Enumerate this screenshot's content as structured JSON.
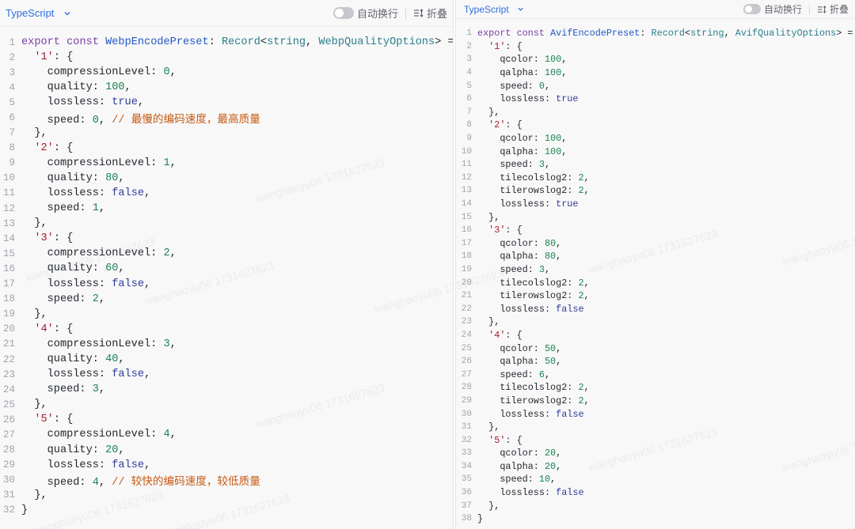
{
  "left_editor": {
    "language": "TypeScript",
    "wrap_label": "自动换行",
    "fold_label": "折叠",
    "wrap_enabled": false,
    "lines": [
      [
        [
          "kw",
          "export"
        ],
        [
          "pl",
          " "
        ],
        [
          "kw",
          "const"
        ],
        [
          "pl",
          " "
        ],
        [
          "fn",
          "WebpEncodePreset"
        ],
        [
          "pl",
          ": "
        ],
        [
          "ty",
          "Record"
        ],
        [
          "pl",
          "<"
        ],
        [
          "ty",
          "string"
        ],
        [
          "pl",
          ", "
        ],
        [
          "ty",
          "WebpQualityOptions"
        ],
        [
          "pl",
          "> = {"
        ]
      ],
      [
        [
          "pl",
          "  "
        ],
        [
          "str",
          "'1'"
        ],
        [
          "pl",
          ": {"
        ]
      ],
      [
        [
          "pl",
          "    compressionLevel: "
        ],
        [
          "num",
          "0"
        ],
        [
          "pl",
          ","
        ]
      ],
      [
        [
          "pl",
          "    quality: "
        ],
        [
          "num",
          "100"
        ],
        [
          "pl",
          ","
        ]
      ],
      [
        [
          "pl",
          "    lossless: "
        ],
        [
          "bool",
          "true"
        ],
        [
          "pl",
          ","
        ]
      ],
      [
        [
          "pl",
          "    speed: "
        ],
        [
          "num",
          "0"
        ],
        [
          "pl",
          ", "
        ],
        [
          "cm",
          "// 最慢的编码速度，最高质量"
        ]
      ],
      [
        [
          "pl",
          "  },"
        ]
      ],
      [
        [
          "pl",
          "  "
        ],
        [
          "str",
          "'2'"
        ],
        [
          "pl",
          ": {"
        ]
      ],
      [
        [
          "pl",
          "    compressionLevel: "
        ],
        [
          "num",
          "1"
        ],
        [
          "pl",
          ","
        ]
      ],
      [
        [
          "pl",
          "    quality: "
        ],
        [
          "num",
          "80"
        ],
        [
          "pl",
          ","
        ]
      ],
      [
        [
          "pl",
          "    lossless: "
        ],
        [
          "bool",
          "false"
        ],
        [
          "pl",
          ","
        ]
      ],
      [
        [
          "pl",
          "    speed: "
        ],
        [
          "num",
          "1"
        ],
        [
          "pl",
          ","
        ]
      ],
      [
        [
          "pl",
          "  },"
        ]
      ],
      [
        [
          "pl",
          "  "
        ],
        [
          "str",
          "'3'"
        ],
        [
          "pl",
          ": {"
        ]
      ],
      [
        [
          "pl",
          "    compressionLevel: "
        ],
        [
          "num",
          "2"
        ],
        [
          "pl",
          ","
        ]
      ],
      [
        [
          "pl",
          "    quality: "
        ],
        [
          "num",
          "60"
        ],
        [
          "pl",
          ","
        ]
      ],
      [
        [
          "pl",
          "    lossless: "
        ],
        [
          "bool",
          "false"
        ],
        [
          "pl",
          ","
        ]
      ],
      [
        [
          "pl",
          "    speed: "
        ],
        [
          "num",
          "2"
        ],
        [
          "pl",
          ","
        ]
      ],
      [
        [
          "pl",
          "  },"
        ]
      ],
      [
        [
          "pl",
          "  "
        ],
        [
          "str",
          "'4'"
        ],
        [
          "pl",
          ": {"
        ]
      ],
      [
        [
          "pl",
          "    compressionLevel: "
        ],
        [
          "num",
          "3"
        ],
        [
          "pl",
          ","
        ]
      ],
      [
        [
          "pl",
          "    quality: "
        ],
        [
          "num",
          "40"
        ],
        [
          "pl",
          ","
        ]
      ],
      [
        [
          "pl",
          "    lossless: "
        ],
        [
          "bool",
          "false"
        ],
        [
          "pl",
          ","
        ]
      ],
      [
        [
          "pl",
          "    speed: "
        ],
        [
          "num",
          "3"
        ],
        [
          "pl",
          ","
        ]
      ],
      [
        [
          "pl",
          "  },"
        ]
      ],
      [
        [
          "pl",
          "  "
        ],
        [
          "str",
          "'5'"
        ],
        [
          "pl",
          ": {"
        ]
      ],
      [
        [
          "pl",
          "    compressionLevel: "
        ],
        [
          "num",
          "4"
        ],
        [
          "pl",
          ","
        ]
      ],
      [
        [
          "pl",
          "    quality: "
        ],
        [
          "num",
          "20"
        ],
        [
          "pl",
          ","
        ]
      ],
      [
        [
          "pl",
          "    lossless: "
        ],
        [
          "bool",
          "false"
        ],
        [
          "pl",
          ","
        ]
      ],
      [
        [
          "pl",
          "    speed: "
        ],
        [
          "num",
          "4"
        ],
        [
          "pl",
          ", "
        ],
        [
          "cm",
          "// 较快的编码速度，较低质量"
        ]
      ],
      [
        [
          "pl",
          "  },"
        ]
      ],
      [
        [
          "pl",
          "}"
        ]
      ]
    ]
  },
  "right_editor": {
    "language": "TypeScript",
    "wrap_label": "自动换行",
    "fold_label": "折叠",
    "wrap_enabled": false,
    "lines": [
      [
        [
          "kw",
          "export"
        ],
        [
          "pl",
          " "
        ],
        [
          "kw",
          "const"
        ],
        [
          "pl",
          " "
        ],
        [
          "fn",
          "AvifEncodePreset"
        ],
        [
          "pl",
          ": "
        ],
        [
          "ty",
          "Record"
        ],
        [
          "pl",
          "<"
        ],
        [
          "ty",
          "string"
        ],
        [
          "pl",
          ", "
        ],
        [
          "ty",
          "AvifQualityOptions"
        ],
        [
          "pl",
          "> = {"
        ]
      ],
      [
        [
          "pl",
          "  "
        ],
        [
          "str",
          "'1'"
        ],
        [
          "pl",
          ": {"
        ]
      ],
      [
        [
          "pl",
          "    qcolor: "
        ],
        [
          "num",
          "100"
        ],
        [
          "pl",
          ","
        ]
      ],
      [
        [
          "pl",
          "    qalpha: "
        ],
        [
          "num",
          "100"
        ],
        [
          "pl",
          ","
        ]
      ],
      [
        [
          "pl",
          "    speed: "
        ],
        [
          "num",
          "0"
        ],
        [
          "pl",
          ","
        ]
      ],
      [
        [
          "pl",
          "    lossless: "
        ],
        [
          "bool",
          "true"
        ]
      ],
      [
        [
          "pl",
          "  },"
        ]
      ],
      [
        [
          "pl",
          "  "
        ],
        [
          "str",
          "'2'"
        ],
        [
          "pl",
          ": {"
        ]
      ],
      [
        [
          "pl",
          "    qcolor: "
        ],
        [
          "num",
          "100"
        ],
        [
          "pl",
          ","
        ]
      ],
      [
        [
          "pl",
          "    qalpha: "
        ],
        [
          "num",
          "100"
        ],
        [
          "pl",
          ","
        ]
      ],
      [
        [
          "pl",
          "    speed: "
        ],
        [
          "num",
          "3"
        ],
        [
          "pl",
          ","
        ]
      ],
      [
        [
          "pl",
          "    tilecolslog2: "
        ],
        [
          "num",
          "2"
        ],
        [
          "pl",
          ","
        ]
      ],
      [
        [
          "pl",
          "    tilerowslog2: "
        ],
        [
          "num",
          "2"
        ],
        [
          "pl",
          ","
        ]
      ],
      [
        [
          "pl",
          "    lossless: "
        ],
        [
          "bool",
          "true"
        ]
      ],
      [
        [
          "pl",
          "  },"
        ]
      ],
      [
        [
          "pl",
          "  "
        ],
        [
          "str",
          "'3'"
        ],
        [
          "pl",
          ": {"
        ]
      ],
      [
        [
          "pl",
          "    qcolor: "
        ],
        [
          "num",
          "80"
        ],
        [
          "pl",
          ","
        ]
      ],
      [
        [
          "pl",
          "    qalpha: "
        ],
        [
          "num",
          "80"
        ],
        [
          "pl",
          ","
        ]
      ],
      [
        [
          "pl",
          "    speed: "
        ],
        [
          "num",
          "3"
        ],
        [
          "pl",
          ","
        ]
      ],
      [
        [
          "pl",
          "    tilecolslog2: "
        ],
        [
          "num",
          "2"
        ],
        [
          "pl",
          ","
        ]
      ],
      [
        [
          "pl",
          "    tilerowslog2: "
        ],
        [
          "num",
          "2"
        ],
        [
          "pl",
          ","
        ]
      ],
      [
        [
          "pl",
          "    lossless: "
        ],
        [
          "bool",
          "false"
        ]
      ],
      [
        [
          "pl",
          "  },"
        ]
      ],
      [
        [
          "pl",
          "  "
        ],
        [
          "str",
          "'4'"
        ],
        [
          "pl",
          ": {"
        ]
      ],
      [
        [
          "pl",
          "    qcolor: "
        ],
        [
          "num",
          "50"
        ],
        [
          "pl",
          ","
        ]
      ],
      [
        [
          "pl",
          "    qalpha: "
        ],
        [
          "num",
          "50"
        ],
        [
          "pl",
          ","
        ]
      ],
      [
        [
          "pl",
          "    speed: "
        ],
        [
          "num",
          "6"
        ],
        [
          "pl",
          ","
        ]
      ],
      [
        [
          "pl",
          "    tilecolslog2: "
        ],
        [
          "num",
          "2"
        ],
        [
          "pl",
          ","
        ]
      ],
      [
        [
          "pl",
          "    tilerowslog2: "
        ],
        [
          "num",
          "2"
        ],
        [
          "pl",
          ","
        ]
      ],
      [
        [
          "pl",
          "    lossless: "
        ],
        [
          "bool",
          "false"
        ]
      ],
      [
        [
          "pl",
          "  },"
        ]
      ],
      [
        [
          "pl",
          "  "
        ],
        [
          "str",
          "'5'"
        ],
        [
          "pl",
          ": {"
        ]
      ],
      [
        [
          "pl",
          "    qcolor: "
        ],
        [
          "num",
          "20"
        ],
        [
          "pl",
          ","
        ]
      ],
      [
        [
          "pl",
          "    qalpha: "
        ],
        [
          "num",
          "20"
        ],
        [
          "pl",
          ","
        ]
      ],
      [
        [
          "pl",
          "    speed: "
        ],
        [
          "num",
          "10"
        ],
        [
          "pl",
          ","
        ]
      ],
      [
        [
          "pl",
          "    lossless: "
        ],
        [
          "bool",
          "false"
        ]
      ],
      [
        [
          "pl",
          "  },"
        ]
      ],
      [
        [
          "pl",
          "}"
        ]
      ]
    ]
  },
  "watermark_text": "wanghaoyu06 1731627623",
  "colors": {
    "language_label": "#2f6fe0",
    "keyword": "#7a3fa6",
    "type": "#2a7e8c",
    "function": "#2157c6",
    "string": "#a51d2d",
    "number": "#1a8450",
    "boolean": "#2f3b9a",
    "comment": "#c55a11",
    "line_number": "#a0a3aa",
    "background": "#f8f8f9"
  },
  "icons": {
    "language_dropdown": "chevron-down-icon",
    "wrap_toggle": "toggle-switch-icon",
    "fold": "fold-lines-icon"
  }
}
